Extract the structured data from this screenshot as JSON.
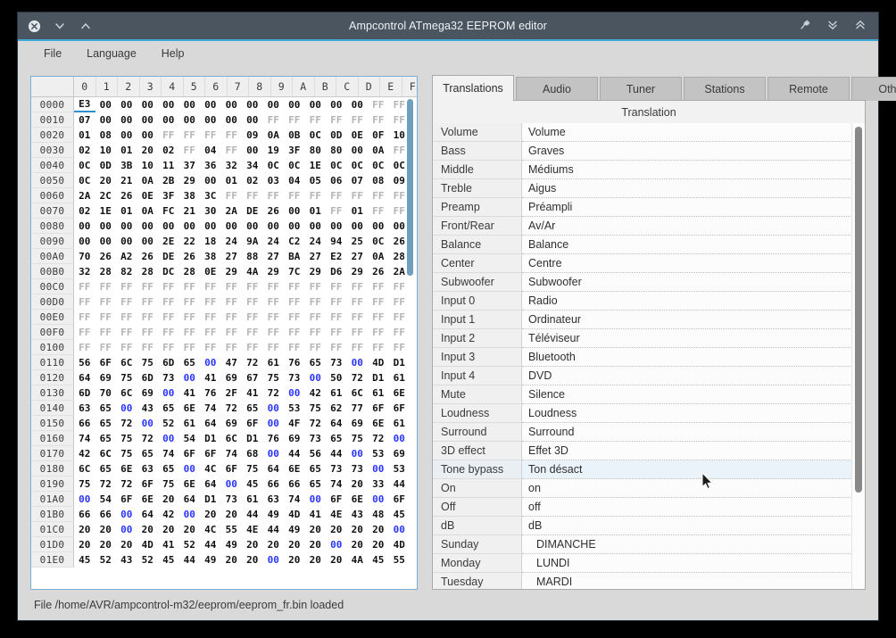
{
  "window": {
    "title": "Ampcontrol ATmega32 EEPROM editor",
    "titlebar_buttons_left": [
      {
        "name": "close-icon",
        "glyph": "x-circle"
      },
      {
        "name": "chevron-down-icon",
        "glyph": "chevron-down"
      },
      {
        "name": "chevron-up-icon",
        "glyph": "chevron-up"
      }
    ],
    "titlebar_buttons_right": [
      {
        "name": "pin-icon",
        "glyph": "pin"
      },
      {
        "name": "double-chevron-down-icon",
        "glyph": "dchevron-down"
      },
      {
        "name": "double-chevron-up-icon",
        "glyph": "dchevron-up"
      }
    ],
    "accent_color": "#3fa9d8",
    "titlebar_color": "#4b5560"
  },
  "menubar": {
    "items": [
      "File",
      "Language",
      "Help"
    ]
  },
  "hex_editor": {
    "column_headers": [
      "0",
      "1",
      "2",
      "3",
      "4",
      "5",
      "6",
      "7",
      "8",
      "9",
      "A",
      "B",
      "C",
      "D",
      "E",
      "F"
    ],
    "cursor_address": "0000",
    "cursor_column": 0,
    "rows": [
      {
        "addr": "0000",
        "bytes": [
          "E3",
          "00",
          "00",
          "00",
          "00",
          "00",
          "00",
          "00",
          "00",
          "00",
          "00",
          "00",
          "00",
          "00",
          "FF",
          "FF"
        ]
      },
      {
        "addr": "0010",
        "bytes": [
          "07",
          "00",
          "00",
          "00",
          "00",
          "00",
          "00",
          "00",
          "00",
          "FF",
          "FF",
          "FF",
          "FF",
          "FF",
          "FF",
          "FF"
        ]
      },
      {
        "addr": "0020",
        "bytes": [
          "01",
          "08",
          "00",
          "00",
          "FF",
          "FF",
          "FF",
          "FF",
          "09",
          "0A",
          "0B",
          "0C",
          "0D",
          "0E",
          "0F",
          "10"
        ]
      },
      {
        "addr": "0030",
        "bytes": [
          "02",
          "10",
          "01",
          "20",
          "02",
          "FF",
          "04",
          "FF",
          "00",
          "19",
          "3F",
          "80",
          "80",
          "00",
          "0A",
          "FF"
        ]
      },
      {
        "addr": "0040",
        "bytes": [
          "0C",
          "0D",
          "3B",
          "10",
          "11",
          "37",
          "36",
          "32",
          "34",
          "0C",
          "0C",
          "1E",
          "0C",
          "0C",
          "0C",
          "0C"
        ]
      },
      {
        "addr": "0050",
        "bytes": [
          "0C",
          "20",
          "21",
          "0A",
          "2B",
          "29",
          "00",
          "01",
          "02",
          "03",
          "04",
          "05",
          "06",
          "07",
          "08",
          "09"
        ]
      },
      {
        "addr": "0060",
        "bytes": [
          "2A",
          "2C",
          "26",
          "0E",
          "3F",
          "38",
          "3C",
          "FF",
          "FF",
          "FF",
          "FF",
          "FF",
          "FF",
          "FF",
          "FF",
          "FF"
        ]
      },
      {
        "addr": "0070",
        "bytes": [
          "02",
          "1E",
          "01",
          "0A",
          "FC",
          "21",
          "30",
          "2A",
          "DE",
          "26",
          "00",
          "01",
          "FF",
          "01",
          "FF",
          "FF"
        ]
      },
      {
        "addr": "0080",
        "bytes": [
          "00",
          "00",
          "00",
          "00",
          "00",
          "00",
          "00",
          "00",
          "00",
          "00",
          "00",
          "00",
          "00",
          "00",
          "00",
          "00"
        ]
      },
      {
        "addr": "0090",
        "bytes": [
          "00",
          "00",
          "00",
          "00",
          "2E",
          "22",
          "18",
          "24",
          "9A",
          "24",
          "C2",
          "24",
          "94",
          "25",
          "0C",
          "26"
        ]
      },
      {
        "addr": "00A0",
        "bytes": [
          "70",
          "26",
          "A2",
          "26",
          "DE",
          "26",
          "38",
          "27",
          "88",
          "27",
          "BA",
          "27",
          "E2",
          "27",
          "0A",
          "28"
        ]
      },
      {
        "addr": "00B0",
        "bytes": [
          "32",
          "28",
          "82",
          "28",
          "DC",
          "28",
          "0E",
          "29",
          "4A",
          "29",
          "7C",
          "29",
          "D6",
          "29",
          "26",
          "2A"
        ]
      },
      {
        "addr": "00C0",
        "bytes": [
          "FF",
          "FF",
          "FF",
          "FF",
          "FF",
          "FF",
          "FF",
          "FF",
          "FF",
          "FF",
          "FF",
          "FF",
          "FF",
          "FF",
          "FF",
          "FF"
        ]
      },
      {
        "addr": "00D0",
        "bytes": [
          "FF",
          "FF",
          "FF",
          "FF",
          "FF",
          "FF",
          "FF",
          "FF",
          "FF",
          "FF",
          "FF",
          "FF",
          "FF",
          "FF",
          "FF",
          "FF"
        ]
      },
      {
        "addr": "00E0",
        "bytes": [
          "FF",
          "FF",
          "FF",
          "FF",
          "FF",
          "FF",
          "FF",
          "FF",
          "FF",
          "FF",
          "FF",
          "FF",
          "FF",
          "FF",
          "FF",
          "FF"
        ]
      },
      {
        "addr": "00F0",
        "bytes": [
          "FF",
          "FF",
          "FF",
          "FF",
          "FF",
          "FF",
          "FF",
          "FF",
          "FF",
          "FF",
          "FF",
          "FF",
          "FF",
          "FF",
          "FF",
          "FF"
        ]
      },
      {
        "addr": "0100",
        "bytes": [
          "FF",
          "FF",
          "FF",
          "FF",
          "FF",
          "FF",
          "FF",
          "FF",
          "FF",
          "FF",
          "FF",
          "FF",
          "FF",
          "FF",
          "FF",
          "FF"
        ]
      },
      {
        "addr": "0110",
        "bytes": [
          "56",
          "6F",
          "6C",
          "75",
          "6D",
          "65",
          "00",
          "47",
          "72",
          "61",
          "76",
          "65",
          "73",
          "00",
          "4D",
          "D1"
        ]
      },
      {
        "addr": "0120",
        "bytes": [
          "64",
          "69",
          "75",
          "6D",
          "73",
          "00",
          "41",
          "69",
          "67",
          "75",
          "73",
          "00",
          "50",
          "72",
          "D1",
          "61"
        ]
      },
      {
        "addr": "0130",
        "bytes": [
          "6D",
          "70",
          "6C",
          "69",
          "00",
          "41",
          "76",
          "2F",
          "41",
          "72",
          "00",
          "42",
          "61",
          "6C",
          "61",
          "6E"
        ]
      },
      {
        "addr": "0140",
        "bytes": [
          "63",
          "65",
          "00",
          "43",
          "65",
          "6E",
          "74",
          "72",
          "65",
          "00",
          "53",
          "75",
          "62",
          "77",
          "6F",
          "6F"
        ]
      },
      {
        "addr": "0150",
        "bytes": [
          "66",
          "65",
          "72",
          "00",
          "52",
          "61",
          "64",
          "69",
          "6F",
          "00",
          "4F",
          "72",
          "64",
          "69",
          "6E",
          "61"
        ]
      },
      {
        "addr": "0160",
        "bytes": [
          "74",
          "65",
          "75",
          "72",
          "00",
          "54",
          "D1",
          "6C",
          "D1",
          "76",
          "69",
          "73",
          "65",
          "75",
          "72",
          "00"
        ]
      },
      {
        "addr": "0170",
        "bytes": [
          "42",
          "6C",
          "75",
          "65",
          "74",
          "6F",
          "6F",
          "74",
          "68",
          "00",
          "44",
          "56",
          "44",
          "00",
          "53",
          "69"
        ]
      },
      {
        "addr": "0180",
        "bytes": [
          "6C",
          "65",
          "6E",
          "63",
          "65",
          "00",
          "4C",
          "6F",
          "75",
          "64",
          "6E",
          "65",
          "73",
          "73",
          "00",
          "53"
        ]
      },
      {
        "addr": "0190",
        "bytes": [
          "75",
          "72",
          "72",
          "6F",
          "75",
          "6E",
          "64",
          "00",
          "45",
          "66",
          "66",
          "65",
          "74",
          "20",
          "33",
          "44"
        ]
      },
      {
        "addr": "01A0",
        "bytes": [
          "00",
          "54",
          "6F",
          "6E",
          "20",
          "64",
          "D1",
          "73",
          "61",
          "63",
          "74",
          "00",
          "6F",
          "6E",
          "00",
          "6F"
        ]
      },
      {
        "addr": "01B0",
        "bytes": [
          "66",
          "66",
          "00",
          "64",
          "42",
          "00",
          "20",
          "20",
          "44",
          "49",
          "4D",
          "41",
          "4E",
          "43",
          "48",
          "45"
        ]
      },
      {
        "addr": "01C0",
        "bytes": [
          "20",
          "20",
          "00",
          "20",
          "20",
          "20",
          "4C",
          "55",
          "4E",
          "44",
          "49",
          "20",
          "20",
          "20",
          "20",
          "00"
        ]
      },
      {
        "addr": "01D0",
        "bytes": [
          "20",
          "20",
          "20",
          "4D",
          "41",
          "52",
          "44",
          "49",
          "20",
          "20",
          "20",
          "20",
          "00",
          "20",
          "20",
          "4D"
        ]
      },
      {
        "addr": "01E0",
        "bytes": [
          "45",
          "52",
          "43",
          "52",
          "45",
          "44",
          "49",
          "20",
          "20",
          "00",
          "20",
          "20",
          "20",
          "4A",
          "45",
          "55"
        ]
      }
    ]
  },
  "tabs": {
    "items": [
      "Translations",
      "Audio",
      "Tuner",
      "Stations",
      "Remote",
      "Other"
    ],
    "active": "Translations"
  },
  "translation_panel": {
    "column_header": "Translation",
    "selected_row": "Tone bypass",
    "rows": [
      {
        "key": "Volume",
        "value": "Volume",
        "indent": false
      },
      {
        "key": "Bass",
        "value": "Graves",
        "indent": false
      },
      {
        "key": "Middle",
        "value": "Médiums",
        "indent": false
      },
      {
        "key": "Treble",
        "value": "Aigus",
        "indent": false
      },
      {
        "key": "Preamp",
        "value": "Préampli",
        "indent": false
      },
      {
        "key": "Front/Rear",
        "value": "Av/Ar",
        "indent": false
      },
      {
        "key": "Balance",
        "value": "Balance",
        "indent": false
      },
      {
        "key": "Center",
        "value": "Centre",
        "indent": false
      },
      {
        "key": "Subwoofer",
        "value": "Subwoofer",
        "indent": false
      },
      {
        "key": "Input 0",
        "value": "Radio",
        "indent": false
      },
      {
        "key": "Input 1",
        "value": "Ordinateur",
        "indent": false
      },
      {
        "key": "Input 2",
        "value": "Téléviseur",
        "indent": false
      },
      {
        "key": "Input 3",
        "value": "Bluetooth",
        "indent": false
      },
      {
        "key": "Input 4",
        "value": "DVD",
        "indent": false
      },
      {
        "key": "Mute",
        "value": "Silence",
        "indent": false
      },
      {
        "key": "Loudness",
        "value": "Loudness",
        "indent": false
      },
      {
        "key": "Surround",
        "value": "Surround",
        "indent": false
      },
      {
        "key": "3D effect",
        "value": "Effet 3D",
        "indent": false
      },
      {
        "key": "Tone bypass",
        "value": "Ton désact",
        "indent": false
      },
      {
        "key": "On",
        "value": "on",
        "indent": false
      },
      {
        "key": "Off",
        "value": "off",
        "indent": false
      },
      {
        "key": "dB",
        "value": "dB",
        "indent": false
      },
      {
        "key": "Sunday",
        "value": "DIMANCHE",
        "indent": true
      },
      {
        "key": "Monday",
        "value": "LUNDI",
        "indent": true
      },
      {
        "key": "Tuesday",
        "value": "MARDI",
        "indent": true
      }
    ]
  },
  "statusbar": {
    "text": "File /home/AVR/ampcontrol-m32/eeprom/eeprom_fr.bin loaded"
  }
}
